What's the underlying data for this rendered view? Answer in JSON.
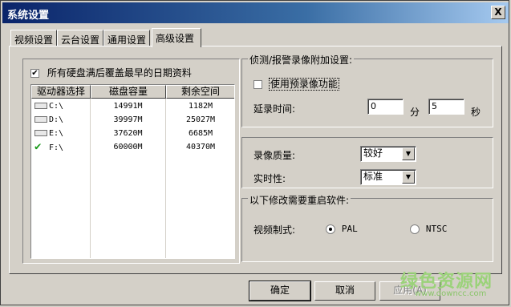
{
  "window": {
    "title": "系统设置",
    "close_glyph": "X"
  },
  "tabs": [
    "视频设置",
    "云台设置",
    "通用设置",
    "高级设置"
  ],
  "left": {
    "overwrite_checkbox": {
      "label": "所有硬盘满后覆盖最早的日期资料",
      "checked": true
    },
    "columns": [
      "驱动器选择",
      "磁盘容量",
      "剩余空间"
    ],
    "rows": [
      {
        "drive": "C:\\",
        "capacity": "14991M",
        "free": "1182M",
        "selected": false
      },
      {
        "drive": "D:\\",
        "capacity": "39997M",
        "free": "25027M",
        "selected": false
      },
      {
        "drive": "E:\\",
        "capacity": "37620M",
        "free": "6685M",
        "selected": false
      },
      {
        "drive": "F:\\",
        "capacity": "60000M",
        "free": "40370M",
        "selected": true
      }
    ]
  },
  "record_group": {
    "title": "侦测/报警录像附加设置:",
    "prerecord_label": "使用预录像功能",
    "prerecord_checked": false,
    "delay_label": "延录时间:",
    "minutes_value": "0",
    "minutes_unit": "分",
    "seconds_value": "5",
    "seconds_unit": "秒"
  },
  "quality_group": {
    "quality_label": "录像质量:",
    "quality_value": "较好",
    "realtime_label": "实时性:",
    "realtime_value": "标准"
  },
  "restart_group": {
    "title": "以下修改需要重启软件:",
    "format_label": "视频制式:",
    "pal_label": "PAL",
    "ntsc_label": "NTSC",
    "selected": "PAL"
  },
  "buttons": {
    "ok": "确定",
    "cancel": "取消",
    "apply": "应用(A)"
  },
  "watermark": {
    "line1": "绿色资源网",
    "line2": "www.downcc.com"
  }
}
